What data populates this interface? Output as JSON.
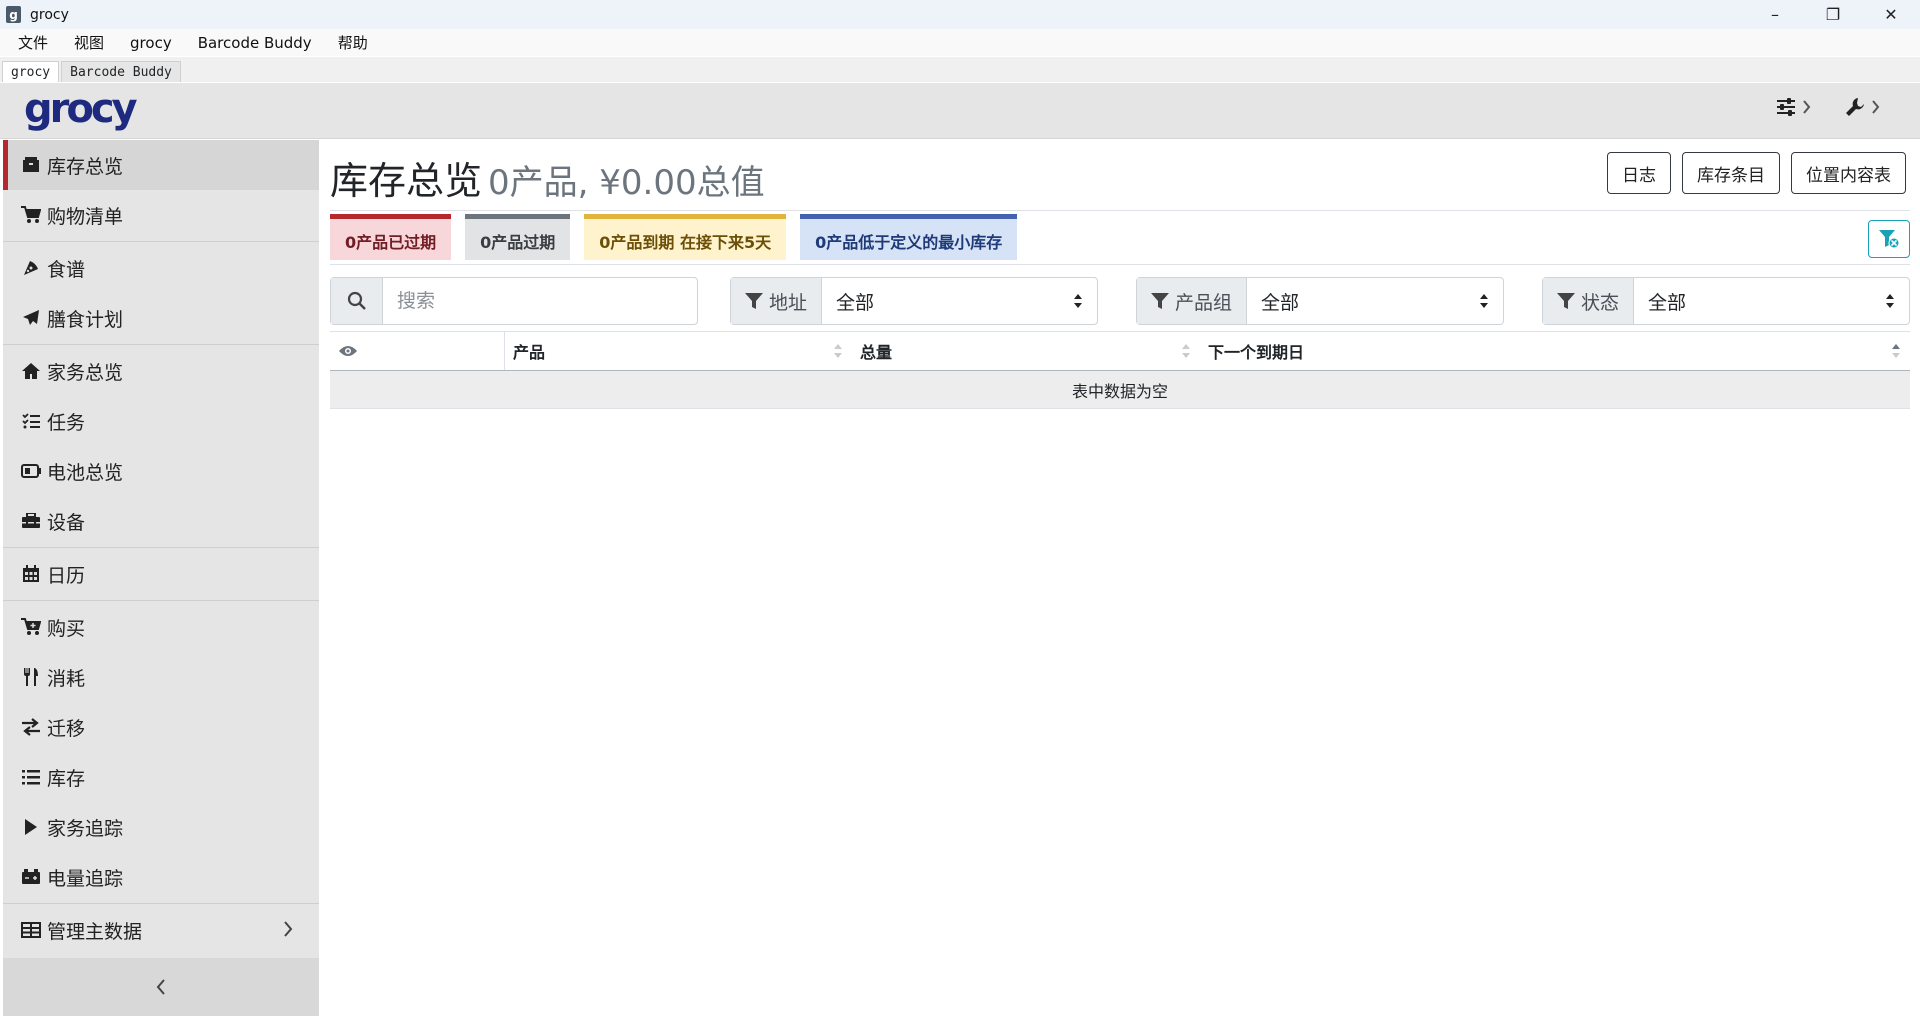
{
  "window": {
    "title": "grocy",
    "app_icon_letter": "g",
    "minimize": "–",
    "maximize": "❐",
    "close": "✕"
  },
  "menubar": [
    "文件",
    "视图",
    "grocy",
    "Barcode Buddy",
    "帮助"
  ],
  "tabs": [
    "grocy",
    "Barcode Buddy"
  ],
  "navbar": {
    "logo": "grocy"
  },
  "sidebar": {
    "items": [
      {
        "label": "库存总览",
        "icon": "box-icon"
      },
      {
        "label": "购物清单",
        "icon": "cart-icon"
      },
      {
        "label": "食谱",
        "icon": "pizza-icon"
      },
      {
        "label": "膳食计划",
        "icon": "paper-plane-icon"
      },
      {
        "label": "家务总览",
        "icon": "home-icon"
      },
      {
        "label": "任务",
        "icon": "tasks-icon"
      },
      {
        "label": "电池总览",
        "icon": "battery-icon"
      },
      {
        "label": "设备",
        "icon": "toolbox-icon"
      },
      {
        "label": "日历",
        "icon": "calendar-icon"
      },
      {
        "label": "购买",
        "icon": "cart-plus-icon"
      },
      {
        "label": "消耗",
        "icon": "utensils-icon"
      },
      {
        "label": "迁移",
        "icon": "exchange-icon"
      },
      {
        "label": "库存",
        "icon": "list-icon"
      },
      {
        "label": "家务追踪",
        "icon": "play-icon"
      },
      {
        "label": "电量追踪",
        "icon": "car-battery-icon"
      },
      {
        "label": "管理主数据",
        "icon": "table-icon"
      }
    ]
  },
  "main": {
    "title": "库存总览",
    "subtitle": "0产品, ¥0.00总值",
    "buttons": [
      "日志",
      "库存条目",
      "位置内容表"
    ],
    "badges": [
      {
        "label": "0产品已过期",
        "variant": "red"
      },
      {
        "label": "0产品过期",
        "variant": "grey"
      },
      {
        "label": "0产品到期 在接下来5天",
        "variant": "yellow"
      },
      {
        "label": "0产品低于定义的最小库存",
        "variant": "blue"
      }
    ],
    "search_placeholder": "搜索",
    "filters": [
      {
        "label": "地址",
        "value": "全部"
      },
      {
        "label": "产品组",
        "value": "全部"
      },
      {
        "label": "状态",
        "value": "全部"
      }
    ],
    "table": {
      "columns": [
        "产品",
        "总量",
        "下一个到期日"
      ],
      "empty_text": "表中数据为空"
    }
  },
  "colors": {
    "accent_red": "#b5282d",
    "logo_blue": "#1e2a80",
    "teal": "#17a2b8"
  }
}
